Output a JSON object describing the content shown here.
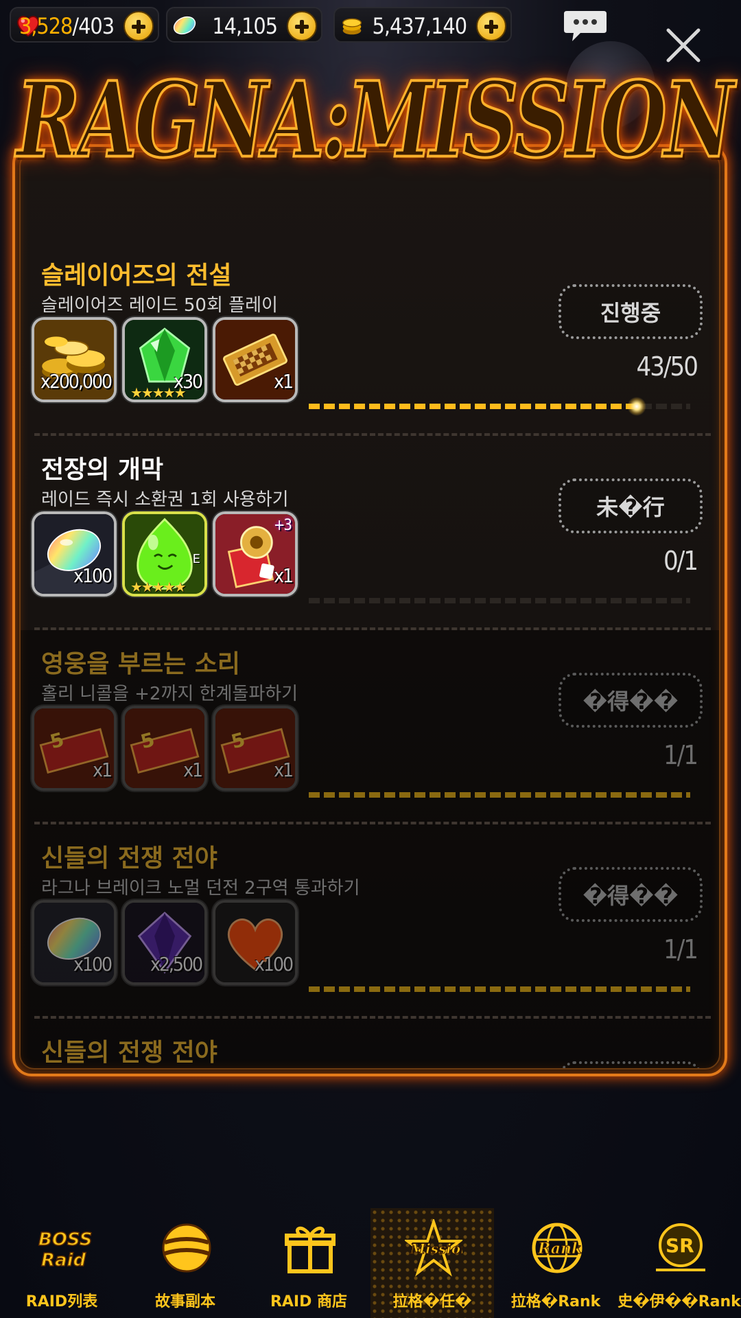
{
  "resources": {
    "hearts_current": "3,528",
    "hearts_max": "/403",
    "gems": "14,105",
    "gold": "5,437,140"
  },
  "logo_text": "RAGNA:MISSION",
  "missions": [
    {
      "title": "슬레이어즈의 전설",
      "description": "슬레이어즈 레이드 50회 플레이",
      "status": "진행중",
      "progress_text": "43/50",
      "progress": 0.86,
      "rewards": [
        {
          "icon": "gold-coins",
          "qty": "x200,000"
        },
        {
          "icon": "green-gem",
          "qty": "x30",
          "stars": "★★★★★"
        },
        {
          "icon": "ticket",
          "qty": "x1"
        }
      ]
    },
    {
      "title": "전장의 개막",
      "description": "레이드 즉시 소환권 1회 사용하기",
      "status": "未�行",
      "progress_text": "0/1",
      "progress": 0,
      "rewards": [
        {
          "icon": "rainbow-gem",
          "qty": "x100"
        },
        {
          "icon": "green-slime",
          "qty": "",
          "grade": "E",
          "stars": "★★★★★"
        },
        {
          "icon": "gift-box",
          "qty": "x1",
          "badge": "+3"
        }
      ]
    },
    {
      "title": "영웅을 부르는 소리",
      "description": "홀리 니콜을 +2까지 한계돌파하기",
      "status": "�得��",
      "progress_text": "1/1",
      "progress": 1,
      "rewards": [
        {
          "icon": "red-ticket",
          "qty": "x1"
        },
        {
          "icon": "red-ticket",
          "qty": "x1"
        },
        {
          "icon": "red-ticket",
          "qty": "x1"
        }
      ]
    },
    {
      "title": "신들의 전쟁 전야",
      "description": "라그나 브레이크 노멀 던전 2구역 통과하기",
      "status": "�得��",
      "progress_text": "1/1",
      "progress": 1,
      "rewards": [
        {
          "icon": "rainbow-gem",
          "qty": "x100"
        },
        {
          "icon": "purple-gem",
          "qty": "x2,500"
        },
        {
          "icon": "heart",
          "qty": "x100"
        }
      ]
    },
    {
      "title": "신들의 전쟁 전야"
    }
  ],
  "nav": [
    {
      "label": "RAID列表",
      "icon": "boss-raid-icon"
    },
    {
      "label": "故事副本",
      "icon": "story-icon"
    },
    {
      "label": "RAID 商店",
      "icon": "gift-icon"
    },
    {
      "label": "拉格�任�",
      "icon": "mission-icon",
      "active": true
    },
    {
      "label": "拉格�Rank",
      "icon": "rank-globe-icon"
    },
    {
      "label": "史�伊��Rank",
      "icon": "slayers-rank-icon"
    }
  ],
  "colors": {
    "accent": "#ffbd2e",
    "frame": "#e37a1a",
    "bar": "#ffbb1c"
  }
}
